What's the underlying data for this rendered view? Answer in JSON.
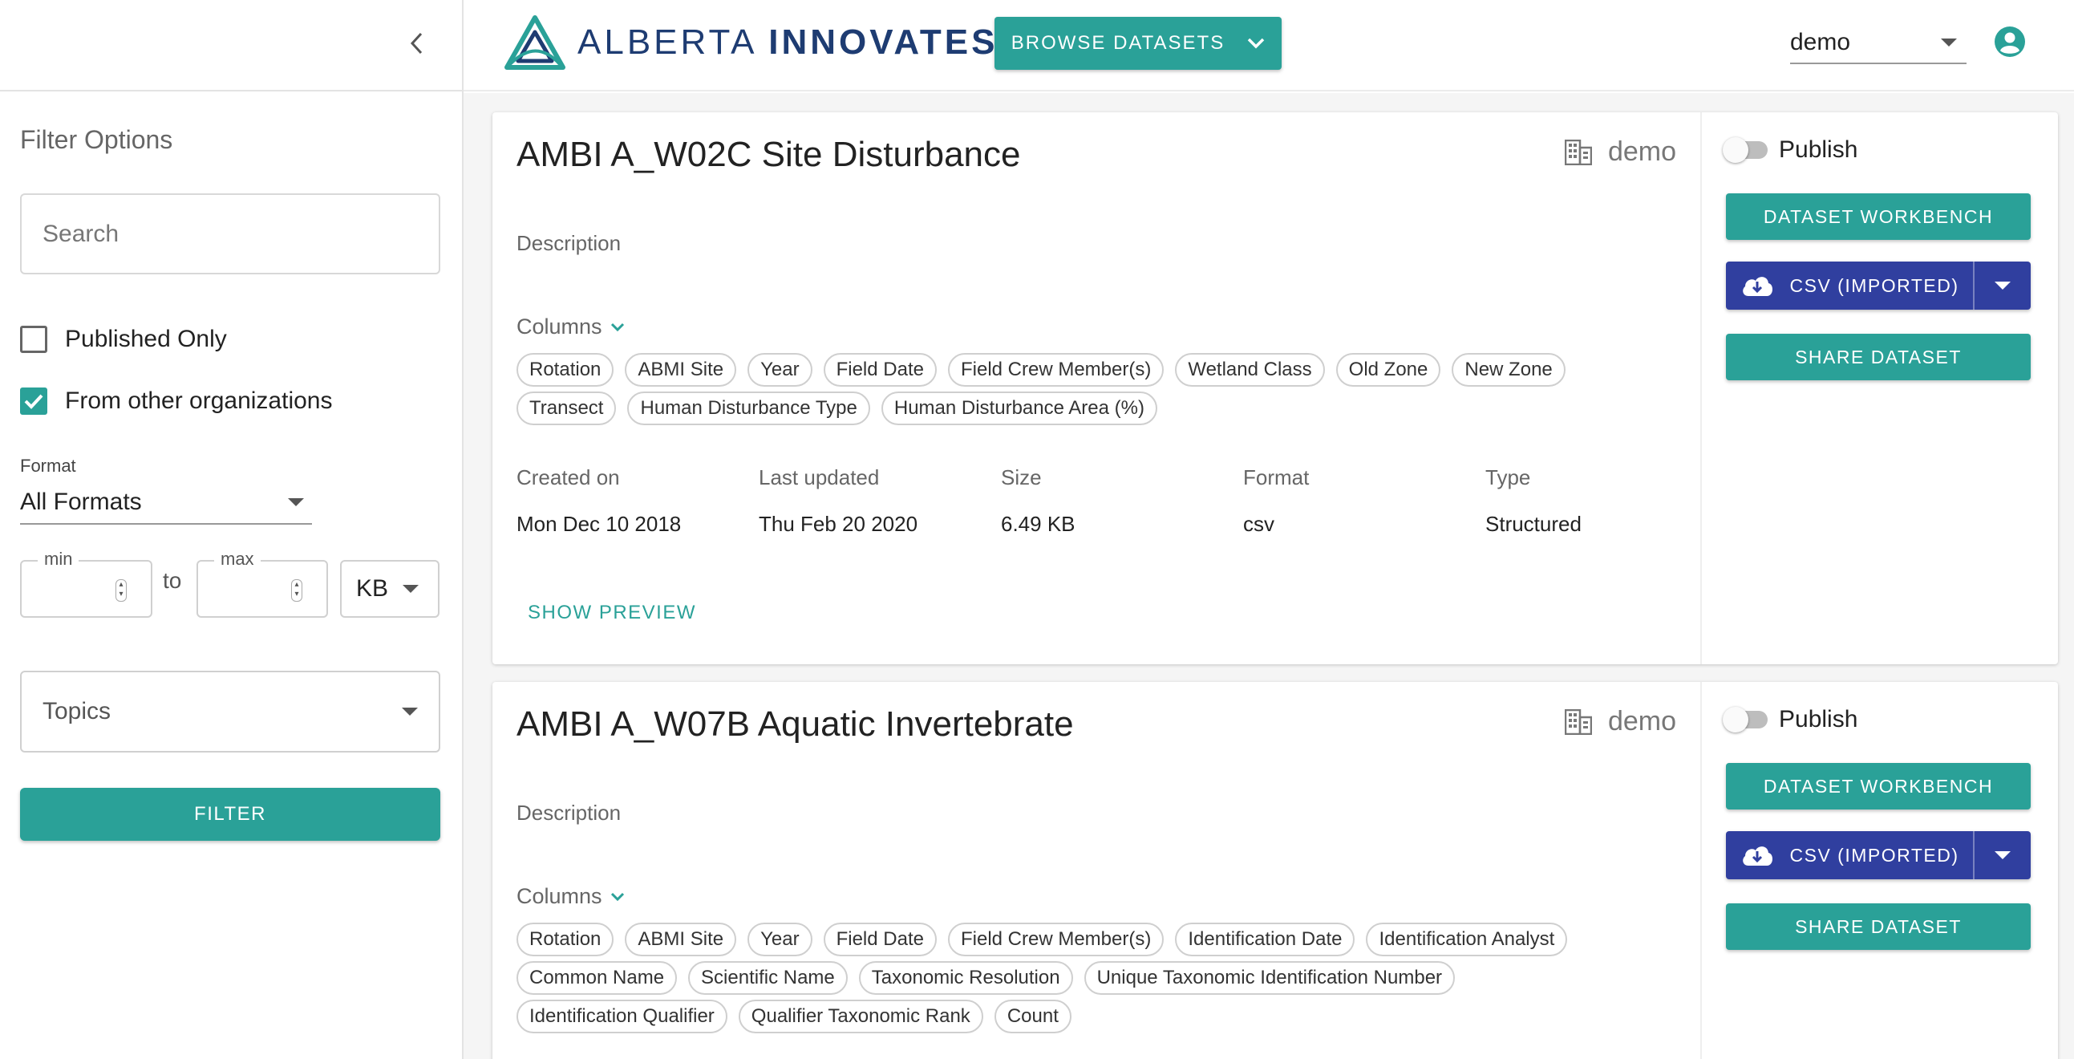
{
  "sidebar": {
    "filter_title": "Filter Options",
    "search_placeholder": "Search",
    "published_only_label": "Published Only",
    "published_only_checked": false,
    "other_orgs_label": "From other organizations",
    "other_orgs_checked": true,
    "format_label": "Format",
    "format_value": "All Formats",
    "min_label": "min",
    "max_label": "max",
    "to_label": "to",
    "unit_value": "KB",
    "topics_placeholder": "Topics",
    "filter_button": "FILTER"
  },
  "header": {
    "logo_text_light": "ALBERTA ",
    "logo_text_bold": "INNOVATES",
    "browse_button": "BROWSE DATASETS",
    "user_value": "demo"
  },
  "colors": {
    "accent": "#2aa198",
    "csv_button": "#303f9f",
    "logo": "#1e3c72"
  },
  "datasets": [
    {
      "title": "AMBI A_W02C Site Disturbance",
      "owner": "demo",
      "description_label": "Description",
      "columns_label": "Columns",
      "columns": [
        "Rotation",
        "ABMI Site",
        "Year",
        "Field Date",
        "Field Crew Member(s)",
        "Wetland Class",
        "Old Zone",
        "New Zone",
        "Transect",
        "Human Disturbance Type",
        "Human Disturbance Area (%)"
      ],
      "meta_headers": [
        "Created on",
        "Last updated",
        "Size",
        "Format",
        "Type"
      ],
      "meta_values": [
        "Mon Dec 10 2018",
        "Thu Feb 20 2020",
        "6.49 KB",
        "csv",
        "Structured"
      ],
      "show_preview": "SHOW PREVIEW",
      "publish_label": "Publish",
      "workbench_button": "DATASET WORKBENCH",
      "csv_button": "CSV (IMPORTED)",
      "share_button": "SHARE DATASET"
    },
    {
      "title": "AMBI A_W07B Aquatic Invertebrate",
      "owner": "demo",
      "description_label": "Description",
      "columns_label": "Columns",
      "columns": [
        "Rotation",
        "ABMI Site",
        "Year",
        "Field Date",
        "Field Crew Member(s)",
        "Identification Date",
        "Identification Analyst",
        "Common Name",
        "Scientific Name",
        "Taxonomic Resolution",
        "Unique Taxonomic Identification Number",
        "Identification Qualifier",
        "Qualifier Taxonomic Rank",
        "Count"
      ],
      "publish_label": "Publish",
      "workbench_button": "DATASET WORKBENCH",
      "csv_button": "CSV (IMPORTED)",
      "share_button": "SHARE DATASET"
    }
  ]
}
